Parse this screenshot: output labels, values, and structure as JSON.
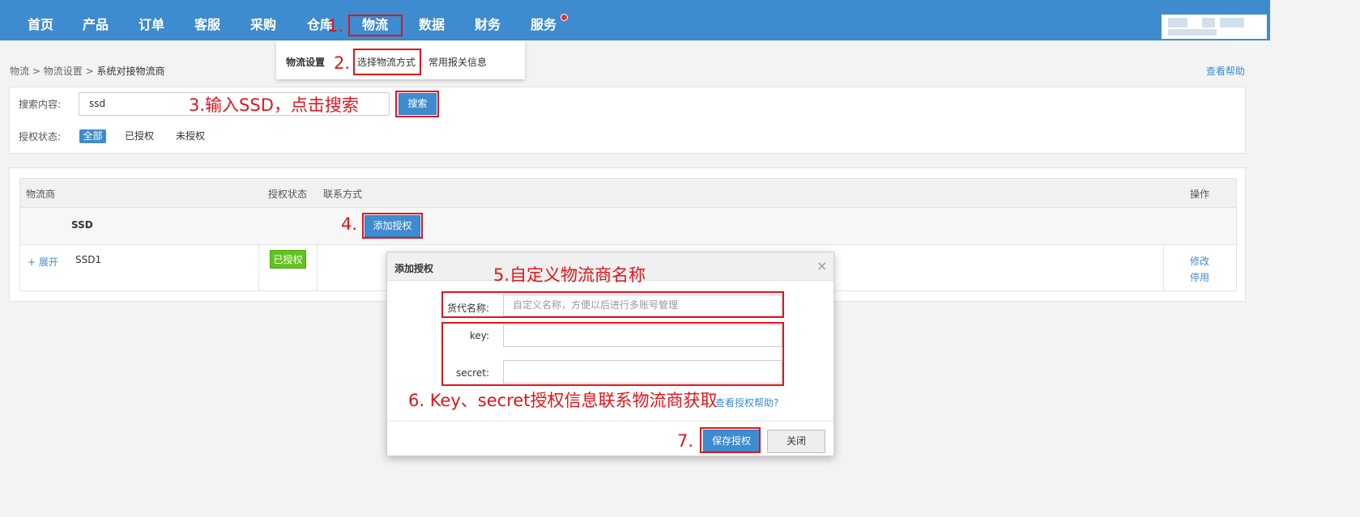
{
  "nav": {
    "items": [
      "首页",
      "产品",
      "订单",
      "客服",
      "采购",
      "仓库",
      "物流",
      "数据",
      "财务",
      "服务"
    ]
  },
  "dropdown": {
    "title": "物流设置",
    "items": [
      "选择物流方式",
      "常用报关信息"
    ]
  },
  "breadcrumb": {
    "items": [
      "物流",
      "物流设置"
    ],
    "separator": ">",
    "current": "系统对接物流商"
  },
  "help_link": "查看帮助",
  "search": {
    "label": "搜索内容:",
    "value": "ssd",
    "button": "搜索"
  },
  "auth_filter": {
    "label": "授权状态:",
    "options": [
      "全部",
      "已授权",
      "未授权"
    ],
    "selected": "全部"
  },
  "table": {
    "headers": [
      "物流商",
      "授权状态",
      "联系方式",
      "操作"
    ],
    "group": {
      "name": "SSD",
      "add_button": "添加授权"
    },
    "rows": [
      {
        "expand": "+ 展开",
        "name": "SSD1",
        "status": "已授权",
        "actions": [
          "修改",
          "停用"
        ]
      }
    ]
  },
  "modal": {
    "title": "添加授权",
    "close_icon": "×",
    "fields": {
      "alias_label": "货代名称:",
      "alias_placeholder": "自定义名称，方便以后进行多账号管理",
      "key_label": "key:",
      "secret_label": "secret:"
    },
    "help_link": "查看授权帮助?",
    "save_button": "保存授权",
    "close_button": "关闭"
  },
  "annotations": {
    "a1": "1.",
    "a2": "2.",
    "a3": "3.输入SSD，点击搜索",
    "a4": "4.",
    "a5": "5.自定义物流商名称",
    "a6": "6. Key、secret授权信息联系物流商获取",
    "a7": "7."
  },
  "colors": {
    "nav_bg": "#3f8bcf",
    "accent": "#3f8bcf",
    "annotation": "#e3141b",
    "authorized": "#62c21f"
  }
}
